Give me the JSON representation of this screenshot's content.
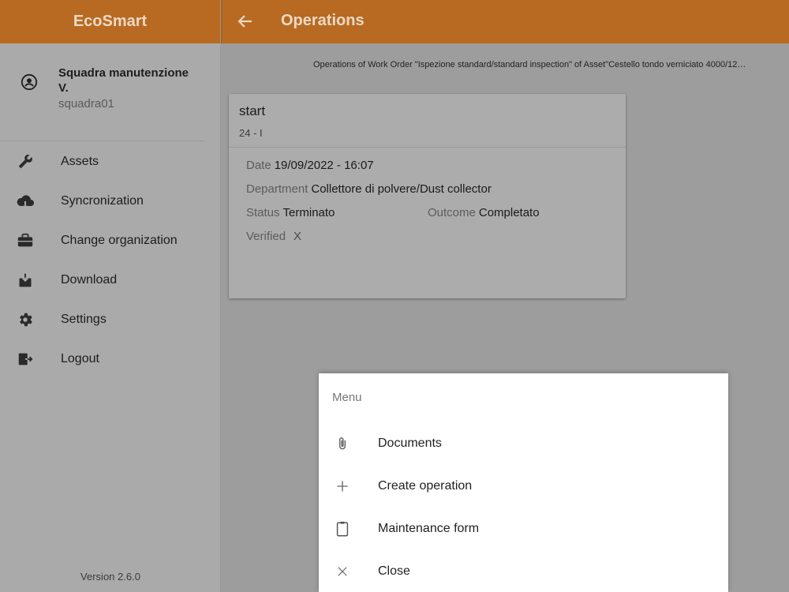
{
  "app": {
    "brand": "EcoSmart",
    "version": "Version 2.6.0"
  },
  "user": {
    "name": "Squadra manutenzione V.",
    "id": "squadra01"
  },
  "sidebar": {
    "items": [
      {
        "label": "Assets",
        "icon": "wrench-icon"
      },
      {
        "label": "Syncronization",
        "icon": "cloud-sync-icon"
      },
      {
        "label": "Change organization",
        "icon": "briefcase-icon"
      },
      {
        "label": "Download",
        "icon": "download-icon"
      },
      {
        "label": "Settings",
        "icon": "gear-icon"
      },
      {
        "label": "Logout",
        "icon": "logout-icon"
      }
    ]
  },
  "header": {
    "title": "Operations"
  },
  "main": {
    "subtitle": "Operations of Work Order \"Ispezione standard/standard inspection\" of Asset\"Cestello tondo verniciato 4000/12…",
    "card": {
      "title": "start",
      "code": "24 - I",
      "date_label": "Date",
      "date_value": "19/09/2022 - 16:07",
      "department_label": "Department",
      "department_value": "Collettore di polvere/Dust collector",
      "status_label": "Status",
      "status_value": "Terminato",
      "outcome_label": "Outcome",
      "outcome_value": "Completato",
      "verified_label": "Verified",
      "verified_value": "X"
    }
  },
  "menu": {
    "header": "Menu",
    "items": [
      {
        "label": "Documents",
        "icon": "paperclip-icon"
      },
      {
        "label": "Create operation",
        "icon": "plus-icon"
      },
      {
        "label": "Maintenance form",
        "icon": "clipboard-icon"
      },
      {
        "label": "Close",
        "icon": "close-icon"
      }
    ]
  },
  "colors": {
    "primary": "#b86a22",
    "header_text": "#ecd9c4",
    "overlay": "#9d9d9d",
    "sidebar": "#aaaaaa"
  }
}
